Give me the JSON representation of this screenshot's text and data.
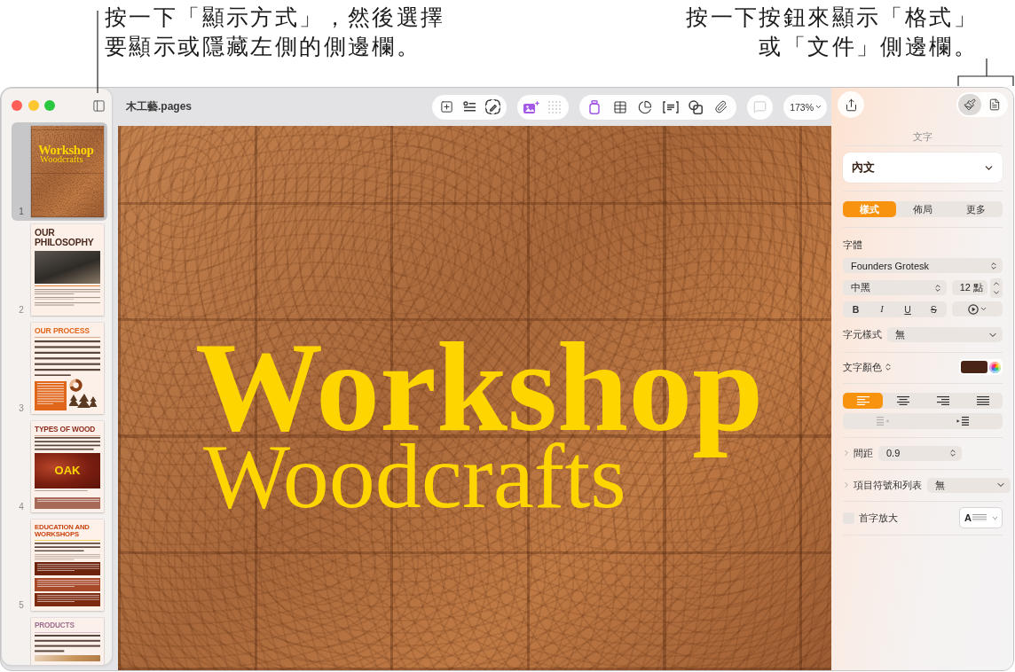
{
  "callouts": [
    {
      "lines": [
        "按一下「顯示方式」，然後選擇",
        "要顯示或隱藏左側的側邊欄。"
      ]
    },
    {
      "lines": [
        "按一下按鈕來顯示「格式」",
        "或「文件」側邊欄。"
      ]
    }
  ],
  "window": {
    "title": "木工藝.pages"
  },
  "pages": [
    {
      "kind": "cover",
      "number": "1",
      "selected": true,
      "title": "Workshop",
      "subtitle": "Woodcrafts"
    },
    {
      "kind": "philosophy",
      "number": "2",
      "selected": false,
      "heading": "OUR PHILOSOPHY"
    },
    {
      "kind": "process",
      "number": "3",
      "selected": false,
      "heading": "OUR PROCESS"
    },
    {
      "kind": "wood",
      "number": "4",
      "selected": false,
      "heading": "TYPES OF WOOD",
      "image_label": "OAK"
    },
    {
      "kind": "education",
      "number": "5",
      "selected": false,
      "heading": "EDUCATION AND WORKSHOPS"
    },
    {
      "kind": "products",
      "selected": false,
      "heading": "PRODUCTS"
    }
  ],
  "toolbar": {
    "groups": [
      {
        "buttons": [
          {
            "disabled": false
          },
          {
            "disabled": false
          },
          {
            "disabled": false
          }
        ]
      },
      {
        "buttons": [
          {
            "disabled": false
          },
          {
            "disabled": true
          }
        ]
      },
      {
        "buttons": [
          {
            "disabled": false
          },
          {
            "disabled": false
          },
          {
            "disabled": false
          },
          {
            "disabled": false
          },
          {
            "disabled": false
          },
          {
            "disabled": false
          }
        ]
      },
      {
        "buttons": [
          {
            "disabled": true
          }
        ]
      }
    ],
    "zoom": "173%"
  },
  "document": {
    "title": "Workshop",
    "subtitle": "Woodcrafts"
  },
  "inspector": {
    "views": [
      {
        "selected": true
      },
      {
        "selected": false
      }
    ],
    "section": "文字",
    "paragraph_style": "內文",
    "tabs": [
      {
        "label": "樣式",
        "selected": true
      },
      {
        "label": "佈局",
        "selected": false
      },
      {
        "label": "更多",
        "selected": false
      }
    ],
    "font_label": "字體",
    "font": "Founders Grotesk",
    "typeface": "中黑",
    "size": "12 點",
    "styles": [
      {
        "kind": "bold",
        "label": "B"
      },
      {
        "kind": "italic",
        "label": "I"
      },
      {
        "kind": "underline",
        "label": "U"
      },
      {
        "kind": "strikethrough",
        "label": "S"
      }
    ],
    "character_style": {
      "label": "字元樣式",
      "value": "無"
    },
    "text_color": {
      "label": "文字顏色",
      "color": "#4a2415"
    },
    "alignment": [
      {
        "selected": true
      },
      {
        "selected": false
      },
      {
        "selected": false
      },
      {
        "selected": false
      }
    ],
    "indent": [
      {
        "disabled": true
      },
      {
        "disabled": false
      }
    ],
    "spacing": {
      "label": "間距",
      "value": "0.9",
      "expanded": false
    },
    "bullets": {
      "label": "項目符號和列表",
      "value": "無",
      "expanded": false
    },
    "drop_cap": {
      "label": "首字放大",
      "checked": false,
      "sample": "A"
    }
  }
}
